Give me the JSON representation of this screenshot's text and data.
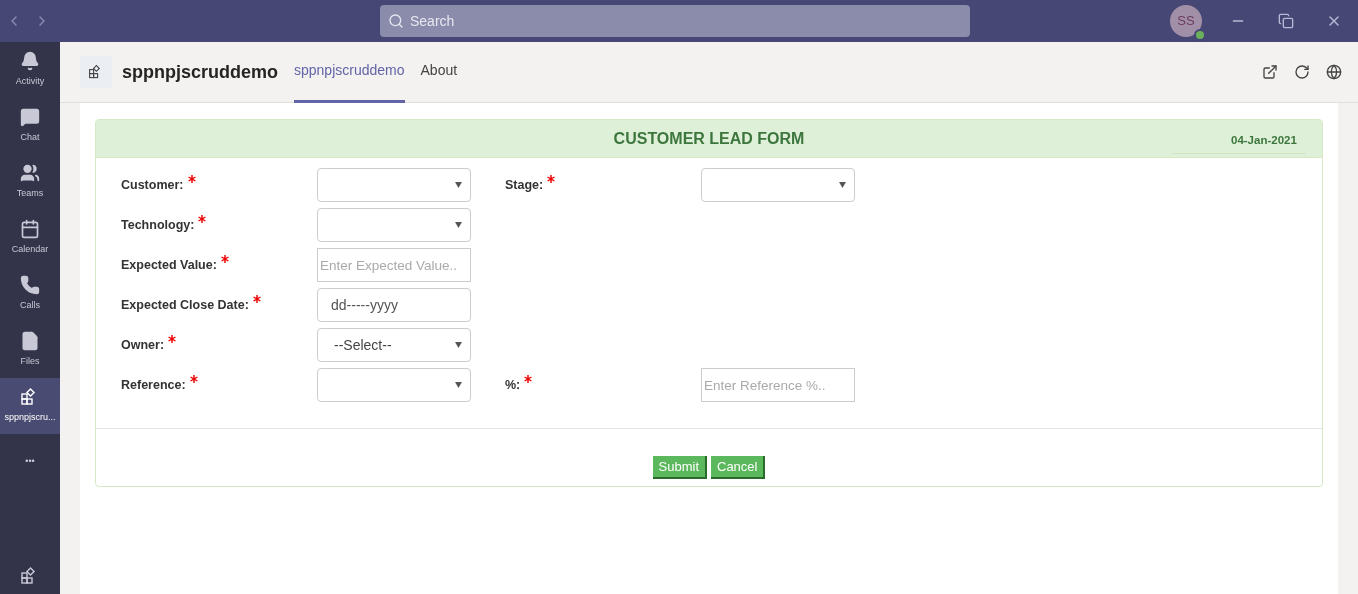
{
  "title_bar": {
    "search": {
      "placeholder": "Search"
    },
    "avatar": {
      "initials": "SS"
    }
  },
  "sidebar": {
    "items": [
      {
        "label": "Activity",
        "selected": false
      },
      {
        "label": "Chat",
        "selected": false
      },
      {
        "label": "Teams",
        "selected": false
      },
      {
        "label": "Calendar",
        "selected": false
      },
      {
        "label": "Calls",
        "selected": false
      },
      {
        "label": "Files",
        "selected": false
      },
      {
        "label": "sppnpjscru...",
        "selected": true
      },
      {
        "label": "•••",
        "selected": false
      }
    ]
  },
  "app_header": {
    "name": "sppnpjscruddemo",
    "tabs": [
      {
        "label": "sppnpjscruddemo",
        "selected": true
      },
      {
        "label": "About",
        "selected": false
      }
    ]
  },
  "form": {
    "title": "CUSTOMER LEAD FORM",
    "date": "04-Jan-2021",
    "rows": [
      {
        "fields": [
          {
            "label": "Customer:",
            "required": true,
            "kind": "select"
          },
          {
            "label": "Stage:",
            "required": true,
            "kind": "select"
          }
        ]
      },
      {
        "fields": [
          {
            "label": "Technology:",
            "required": true,
            "kind": "select"
          }
        ]
      },
      {
        "fields": [
          {
            "label": "Expected Value:",
            "required": true,
            "kind": "text",
            "placeholder": "Enter Expected Value.."
          }
        ]
      },
      {
        "fields": [
          {
            "label": "Expected Close Date:",
            "required": true,
            "kind": "date",
            "value": "dd-----yyyy"
          }
        ]
      },
      {
        "fields": [
          {
            "label": "Owner:",
            "required": true,
            "kind": "select",
            "value": "--Select--"
          }
        ]
      },
      {
        "fields": [
          {
            "label": "Reference:",
            "required": true,
            "kind": "select"
          },
          {
            "label": "%:",
            "required": true,
            "kind": "text",
            "placeholder": "Enter Reference %.."
          }
        ]
      }
    ],
    "buttons": [
      "Submit",
      "Cancel"
    ]
  }
}
